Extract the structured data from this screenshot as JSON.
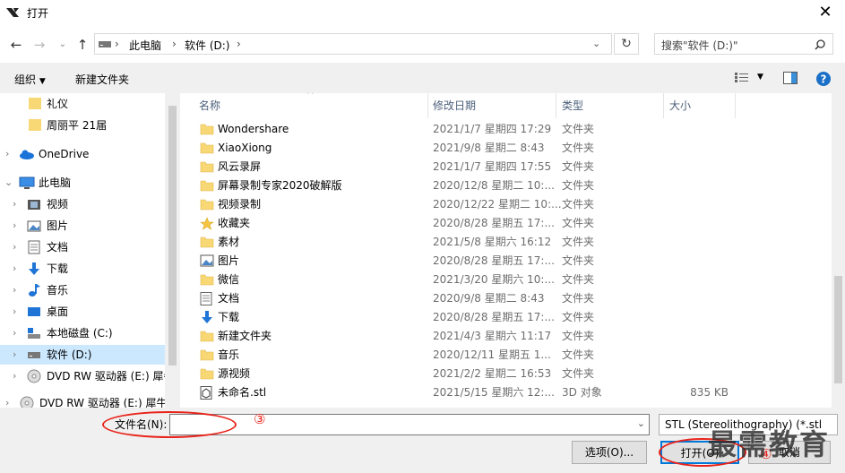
{
  "window": {
    "title": "打开"
  },
  "nav": {
    "breadcrumb": [
      "此电脑",
      "软件 (D:)"
    ],
    "search_placeholder": "搜索\"软件 (D:)\""
  },
  "toolbar": {
    "organize": "组织",
    "new_folder": "新建文件夹"
  },
  "sidebar": {
    "items": [
      {
        "label": "礼仪",
        "icon": "folder-icon"
      },
      {
        "label": "周丽平 21届",
        "icon": "folder-icon"
      },
      {
        "label": "OneDrive",
        "icon": "cloud-icon"
      },
      {
        "label": "此电脑",
        "icon": "computer-icon"
      },
      {
        "label": "视频",
        "icon": "video-icon"
      },
      {
        "label": "图片",
        "icon": "picture-icon"
      },
      {
        "label": "文档",
        "icon": "document-icon"
      },
      {
        "label": "下载",
        "icon": "download-icon"
      },
      {
        "label": "音乐",
        "icon": "music-icon"
      },
      {
        "label": "桌面",
        "icon": "desktop-icon"
      },
      {
        "label": "本地磁盘 (C:)",
        "icon": "disk-icon"
      },
      {
        "label": "软件 (D:)",
        "icon": "drive-icon"
      },
      {
        "label": "DVD RW 驱动器 (E:) 犀牛",
        "icon": "dvd-icon"
      },
      {
        "label": "DVD RW 驱动器 (E:) 犀牛",
        "icon": "dvd-icon"
      }
    ]
  },
  "columns": {
    "name": "名称",
    "date": "修改日期",
    "type": "类型",
    "size": "大小"
  },
  "files": [
    {
      "name": "Wondershare",
      "date": "2021/1/7 星期四 17:29",
      "type": "文件夹",
      "size": "",
      "icon": "folder-icon"
    },
    {
      "name": "XiaoXiong",
      "date": "2021/9/8 星期二 8:43",
      "type": "文件夹",
      "size": "",
      "icon": "folder-icon"
    },
    {
      "name": "风云录屏",
      "date": "2021/1/7 星期四 17:55",
      "type": "文件夹",
      "size": "",
      "icon": "folder-icon"
    },
    {
      "name": "屏幕录制专家2020破解版",
      "date": "2020/12/8 星期二 10:...",
      "type": "文件夹",
      "size": "",
      "icon": "folder-icon"
    },
    {
      "name": "视频录制",
      "date": "2020/12/22 星期二 10:...",
      "type": "文件夹",
      "size": "",
      "icon": "folder-icon"
    },
    {
      "name": "收藏夹",
      "date": "2020/8/28 星期五 17:...",
      "type": "文件夹",
      "size": "",
      "icon": "star-icon"
    },
    {
      "name": "素材",
      "date": "2021/5/8 星期六 16:12",
      "type": "文件夹",
      "size": "",
      "icon": "folder-icon"
    },
    {
      "name": "图片",
      "date": "2020/8/28 星期五 17:...",
      "type": "文件夹",
      "size": "",
      "icon": "picture-icon"
    },
    {
      "name": "微信",
      "date": "2021/3/20 星期六 10:...",
      "type": "文件夹",
      "size": "",
      "icon": "folder-icon"
    },
    {
      "name": "文档",
      "date": "2020/9/8 星期二 8:43",
      "type": "文件夹",
      "size": "",
      "icon": "document-icon"
    },
    {
      "name": "下载",
      "date": "2020/8/28 星期五 17:...",
      "type": "文件夹",
      "size": "",
      "icon": "download-icon"
    },
    {
      "name": "新建文件夹",
      "date": "2021/4/3 星期六 11:17",
      "type": "文件夹",
      "size": "",
      "icon": "folder-icon"
    },
    {
      "name": "音乐",
      "date": "2020/12/11 星期五 1...",
      "type": "文件夹",
      "size": "",
      "icon": "folder-icon"
    },
    {
      "name": "源视频",
      "date": "2021/2/2 星期二 16:53",
      "type": "文件夹",
      "size": "",
      "icon": "folder-icon"
    },
    {
      "name": "未命名.stl",
      "date": "2021/5/15 星期六 12:...",
      "type": "3D 对象",
      "size": "835 KB",
      "icon": "stl-file-icon"
    }
  ],
  "bottom": {
    "filename_label": "文件名(N):",
    "filename_value": "",
    "filetype": "STL (Stereolithography) (*.stl",
    "options_button": "选项(O)...",
    "open_button": "打开(O)",
    "cancel_button": "取消"
  },
  "annotations": {
    "marker_3": "③",
    "marker_4": "④",
    "watermark": "最需教育"
  },
  "colors": {
    "folder": "#f8d775",
    "selection": "#cce8ff",
    "annotation_red": "#e8231a",
    "accent": "#0078d7"
  }
}
